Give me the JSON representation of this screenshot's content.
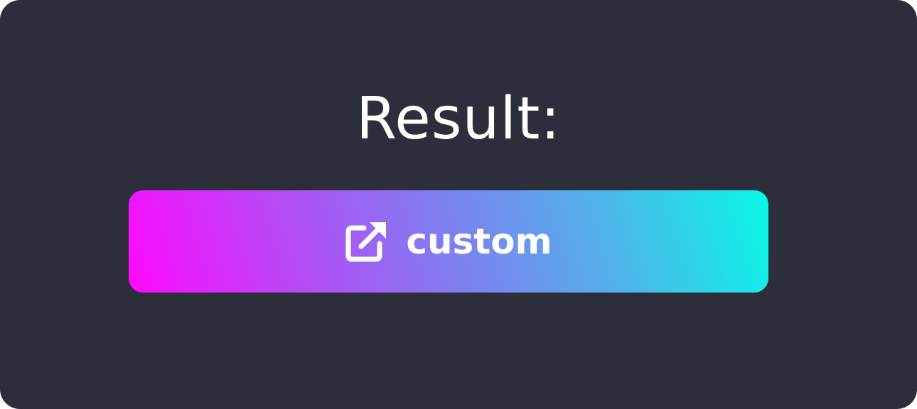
{
  "result": {
    "heading": "Result:"
  },
  "button": {
    "label": "custom",
    "icon": "external-link-icon"
  },
  "colors": {
    "background": "#2c2e3c",
    "text": "#ffffff",
    "gradient_start": "#ff08ff",
    "gradient_end": "#08f9e6"
  }
}
